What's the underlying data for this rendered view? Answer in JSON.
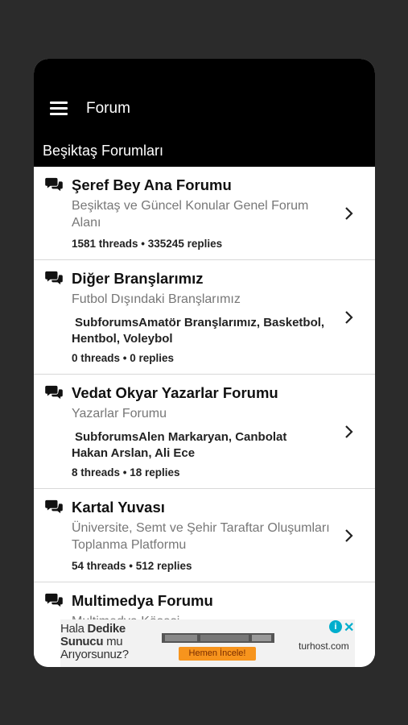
{
  "header": {
    "title": "Forum",
    "section": "Beşiktaş Forumları"
  },
  "forums": [
    {
      "title": "Şeref Bey Ana Forumu",
      "description": "Beşiktaş ve Güncel Konular Genel Forum Alanı",
      "subforums_label": "",
      "subforums": "",
      "stats": "1581 threads • 335245 replies"
    },
    {
      "title": "Diğer Branşlarımız",
      "description": "Futbol Dışındaki Branşlarımız",
      "subforums_label": "Subforums",
      "subforums": "Amatör Branşlarımız, Basketbol, Hentbol, Voleybol",
      "stats": "0 threads • 0 replies"
    },
    {
      "title": "Vedat Okyar Yazarlar Forumu",
      "description": "Yazarlar Forumu",
      "subforums_label": "Subforums",
      "subforums": "Alen Markaryan, Canbolat Hakan Arslan, Ali Ece",
      "stats": "8 threads • 18 replies"
    },
    {
      "title": "Kartal Yuvası",
      "description": "Üniversite, Semt ve Şehir Taraftar Oluşumları Toplanma Platformu",
      "subforums_label": "",
      "subforums": "",
      "stats": "54 threads • 512 replies"
    },
    {
      "title": "Multimedya Forumu",
      "description": "Multimedya Köşesi",
      "subforums_label": "",
      "subforums": "",
      "stats": ""
    }
  ],
  "ad": {
    "line1_a": "Hala ",
    "line1_b": "Dedike",
    "line2_a": "Sunucu",
    "line2_b": " mu",
    "line3": "Arıyorsunuz?",
    "cta": "Hemen İncele!",
    "brand": "turhost.com",
    "info": "i",
    "close": "✕"
  },
  "colors": {
    "appbar": "#000000",
    "background": "#2b2b2b",
    "cta": "#f7941d",
    "ad_accent": "#00aecd"
  },
  "icons": [
    "menu-icon",
    "chat-bubbles-icon",
    "chevron-right-icon",
    "ad-info-icon",
    "ad-close-icon"
  ]
}
